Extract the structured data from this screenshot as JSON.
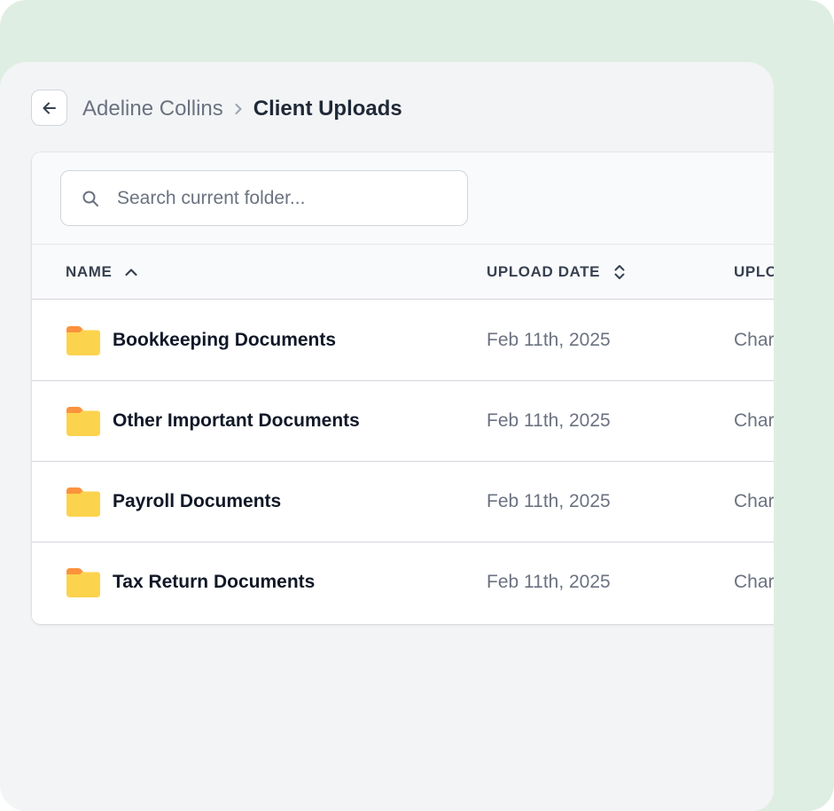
{
  "breadcrumb": {
    "parent": "Adeline Collins",
    "current": "Client Uploads"
  },
  "search": {
    "placeholder": "Search current folder...",
    "value": ""
  },
  "table": {
    "columns": {
      "name": "NAME",
      "upload_date": "UPLOAD DATE",
      "uploader": "UPLO"
    },
    "rows": [
      {
        "name": "Bookkeeping Documents",
        "upload_date": "Feb 11th, 2025",
        "uploader": "Char"
      },
      {
        "name": "Other Important Documents",
        "upload_date": "Feb 11th, 2025",
        "uploader": "Char"
      },
      {
        "name": "Payroll Documents",
        "upload_date": "Feb 11th, 2025",
        "uploader": "Char"
      },
      {
        "name": "Tax Return Documents",
        "upload_date": "Feb 11th, 2025",
        "uploader": "Char"
      }
    ]
  },
  "icons": {
    "back": "arrow-left-icon",
    "breadcrumb_separator": "chevron-right-icon",
    "search": "search-icon",
    "name_sort": "chevron-up-icon",
    "date_sort": "sort-up-down-icon",
    "row": "folder-icon"
  },
  "colors": {
    "background_accent": "#dfeee2",
    "panel": "#f3f4f6",
    "folder": "#fcd34d",
    "folder_tab": "#fb923c",
    "text_primary": "#111827",
    "text_muted": "#6b7280"
  }
}
